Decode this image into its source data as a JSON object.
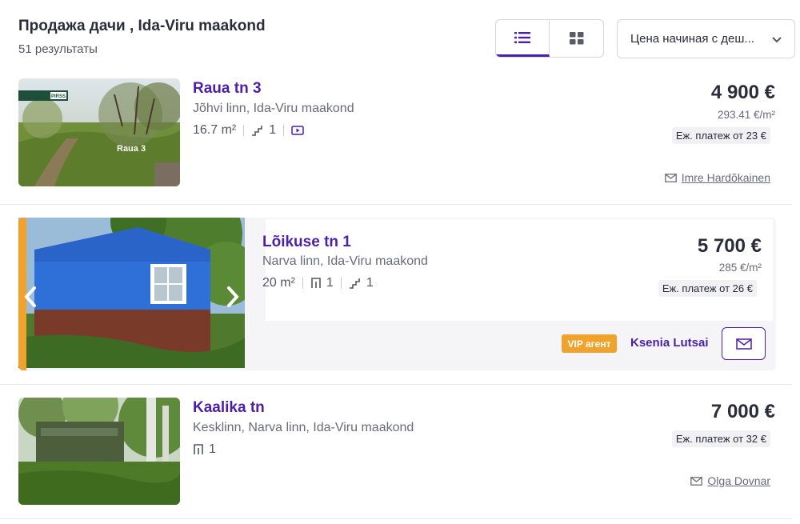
{
  "header": {
    "title": "Продажа дачи , Ida-Viru maakond",
    "result_count": "51 результаты",
    "sort_value": "Цена начиная с деш..."
  },
  "listings": [
    {
      "title": "Raua tn 3",
      "address": "Jõhvi linn, Ida-Viru maakond",
      "area": "16.7 m²",
      "floors": "1",
      "price": "4 900 €",
      "price_per_m2": "293.41 €/m²",
      "monthly": "Еж. платеж от 23 €",
      "agent": "Imre Hardõkainen",
      "photo_caption": "Raua 3"
    },
    {
      "title": "Lõikuse tn 1",
      "address": "Narva linn, Ida-Viru maakond",
      "area": "20 m²",
      "rooms": "1",
      "floors": "1",
      "price": "5 700 €",
      "price_per_m2": "285 €/m²",
      "monthly": "Еж. платеж от 26 €",
      "vip_badge": "VIP агент",
      "agent": "Ksenia Lutsai"
    },
    {
      "title": "Kaalika tn",
      "address": "Kesklinn, Narva linn, Ida-Viru maakond",
      "rooms": "1",
      "price": "7 000 €",
      "monthly": "Еж. платеж от 32 €",
      "agent": "Olga Dovnar"
    }
  ],
  "colors": {
    "accent": "#4b1fa8",
    "vip": "#f0a32c",
    "text": "#2b2b3a",
    "muted": "#6a6a7a"
  },
  "icons": [
    "list-view-icon",
    "grid-view-icon",
    "chevron-down-icon",
    "stairs-icon",
    "video-icon",
    "room-icon",
    "mail-icon",
    "chevron-left-icon",
    "chevron-right-icon"
  ]
}
